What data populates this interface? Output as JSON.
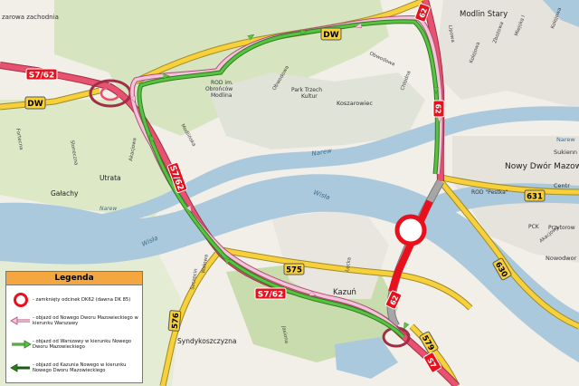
{
  "map": {
    "places": [
      {
        "name": "Modlin Stary"
      },
      {
        "name": "Nowy Dwór Mazowiecki"
      },
      {
        "name": "Utrata"
      },
      {
        "name": "Gałachy"
      },
      {
        "name": "Kazuń"
      },
      {
        "name": "Syndykoszczyzna"
      },
      {
        "name": "Nowodwor"
      },
      {
        "name": "Sukienn"
      },
      {
        "name": "Centr"
      },
      {
        "name": "Przytorow"
      },
      {
        "name": "PCK"
      },
      {
        "name": "Narew"
      }
    ],
    "pois": [
      {
        "name": "ROD im. Obrońców Modlina"
      },
      {
        "name": "Park Trzech Kultur"
      },
      {
        "name": "Koszarowiec"
      },
      {
        "name": "ROD \"Pestka\""
      }
    ],
    "streets": [
      {
        "name": "Obwodowa"
      },
      {
        "name": "Obwodowa"
      },
      {
        "name": "Chlodna"
      },
      {
        "name": "Modlińska"
      },
      {
        "name": "Akacjowa"
      },
      {
        "name": "Słoneczna"
      },
      {
        "name": "Fortecna"
      },
      {
        "name": "Lipowa"
      },
      {
        "name": "Kolejowa"
      },
      {
        "name": "Zbożowa"
      },
      {
        "name": "Miejska I"
      },
      {
        "name": "Lęcka"
      },
      {
        "name": "Szczecin"
      },
      {
        "name": "Jasiona"
      },
      {
        "name": "Kolejowa"
      },
      {
        "name": "Akacjowa"
      },
      {
        "name": "Wałowa"
      }
    ],
    "rivers": [
      {
        "name": "Narew"
      },
      {
        "name": "Wisła"
      },
      {
        "name": "Wisła"
      },
      {
        "name": "Narew"
      }
    ],
    "road_labels": {
      "corner_label": "zarowa zachodnia",
      "s7_62": "S7/62",
      "dw": "DW",
      "dk62": "62",
      "dk631": "631",
      "dk630": "630",
      "dk575": "575",
      "dk579": "579",
      "s7": "S7"
    }
  },
  "legend": {
    "title": "Legenda",
    "items": [
      {
        "text": "- zamknięty odcinek DK62 (dawna DK 85)"
      },
      {
        "text": "- objazd od Nowego Dworu Mazowieckiego w kierunku Warszawy"
      },
      {
        "text": "- objazd od Warszawy w kierunku Nowego Dworu Mazowieckiego"
      },
      {
        "text": "- objazd od Kazunia Nowego w kierunku Nowego Dworu Mazowieckiego"
      }
    ]
  },
  "colors": {
    "land": "#f2efe9",
    "forest": "#c9dcae",
    "water": "#aac9dc",
    "trunk": "#e8516f",
    "secondary": "#f7d03a",
    "detour_pink": "#e9a7c5",
    "detour_green": "#58c243",
    "closed": "#e8101c"
  }
}
